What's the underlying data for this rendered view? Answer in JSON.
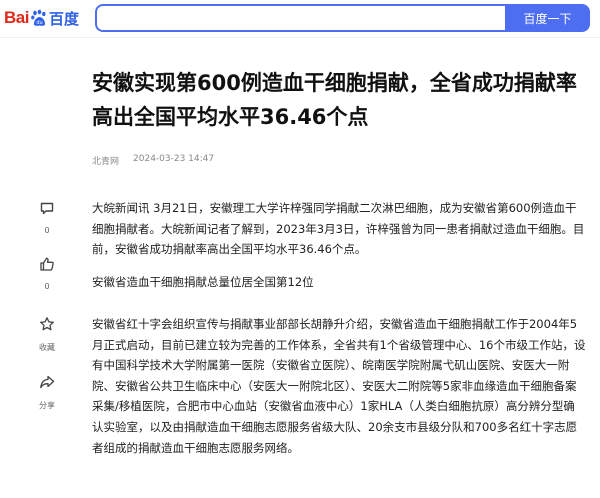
{
  "header": {
    "logo_bai": "Bai",
    "logo_du": "百度",
    "search_button": "百度一下"
  },
  "article": {
    "title": "安徽实现第600例造血干细胞捐献，全省成功捐献率高出全国平均水平36.46个点",
    "source": "北青网",
    "timestamp": "2024-03-23 14:47",
    "paragraphs": [
      "大皖新闻讯 3月21日，安徽理工大学许梓强同学捐献二次淋巴细胞，成为安徽省第600例造血干细胞捐献者。大皖新闻记者了解到，2023年3月3日，许梓强曾为同一患者捐献过造血干细胞。目前，安徽省成功捐献率高出全国平均水平36.46个点。",
      "安徽省造血干细胞捐献总量位居全国第12位",
      "安徽省红十字会组织宣传与捐献事业部部长胡静升介绍，安徽省造血干细胞捐献工作于2004年5月正式启动，目前已建立较为完善的工作体系，全省共有1个省级管理中心、16个市级工作站，设有中国科学技术大学附属第一医院（安徽省立医院）、皖南医学院附属弋矶山医院、安医大一附院、安徽省公共卫生临床中心（安医大一附院北区）、安医大二附院等5家非血缘造血干细胞备案采集/移植医院，合肥市中心血站（安徽省血液中心）1家HLA（人类白细胞抗原）高分辨分型确认实验室，以及由捐献造血干细胞志愿服务省级大队、20余支市县级分队和700多名红十字志愿者组成的捐献造血干细胞志愿服务网络。"
    ]
  },
  "sidebar": {
    "comment_count": "0",
    "like_count": "0",
    "favorite_label": "收藏",
    "share_label": "分享"
  },
  "colors": {
    "brand_red": "#de2a1c",
    "brand_blue": "#4e6ef2"
  },
  "icons": [
    "baidu-paw-icon",
    "comment-icon",
    "thumbs-up-icon",
    "star-icon",
    "share-icon"
  ]
}
